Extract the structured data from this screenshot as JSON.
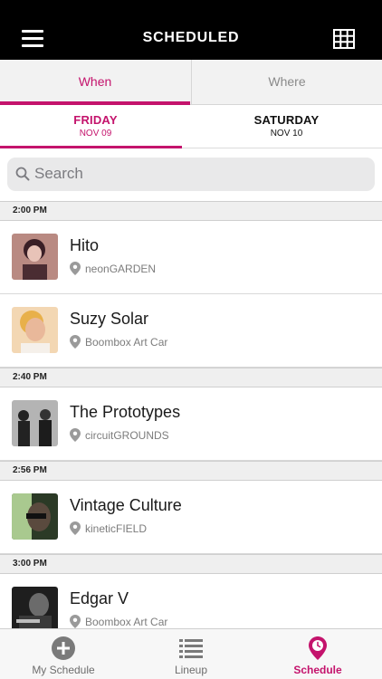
{
  "header": {
    "title": "SCHEDULED",
    "menu_icon": "hamburger-menu-icon",
    "grid_icon": "grid-view-icon"
  },
  "segments": [
    {
      "label": "When",
      "selected": true
    },
    {
      "label": "Where",
      "selected": false
    }
  ],
  "days": [
    {
      "name": "FRIDAY",
      "date": "NOV 09",
      "selected": true
    },
    {
      "name": "SATURDAY",
      "date": "NOV 10",
      "selected": false
    }
  ],
  "search": {
    "placeholder": "Search",
    "icon": "search-icon"
  },
  "schedule": [
    {
      "time": "2:00 PM",
      "items": [
        {
          "artist": "Hito",
          "venue": "neonGARDEN"
        },
        {
          "artist": "Suzy Solar",
          "venue": "Boombox Art Car"
        }
      ]
    },
    {
      "time": "2:40 PM",
      "items": [
        {
          "artist": "The Prototypes",
          "venue": "circuitGROUNDS"
        }
      ]
    },
    {
      "time": "2:56 PM",
      "items": [
        {
          "artist": "Vintage Culture",
          "venue": "kineticFIELD"
        }
      ]
    },
    {
      "time": "3:00 PM",
      "items": [
        {
          "artist": "Edgar V",
          "venue": "Boombox Art Car"
        }
      ]
    }
  ],
  "tabbar": [
    {
      "label": "My Schedule",
      "icon": "add-circle-icon",
      "active": false
    },
    {
      "label": "Lineup",
      "icon": "list-icon",
      "active": false
    },
    {
      "label": "Schedule",
      "icon": "map-pin-clock-icon",
      "active": true
    }
  ],
  "colors": {
    "accent": "#c4136c",
    "topbar": "#000000",
    "header_bg": "#efefef"
  }
}
